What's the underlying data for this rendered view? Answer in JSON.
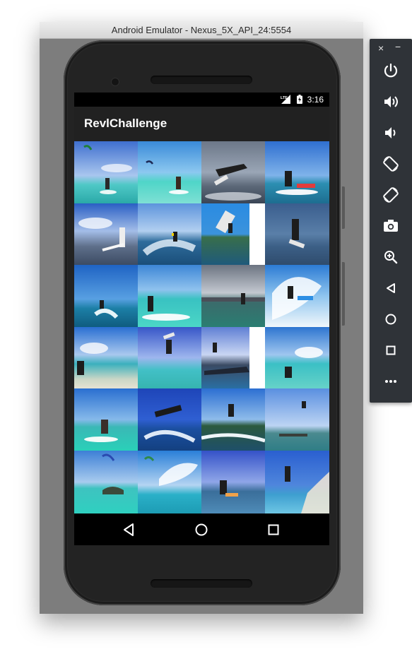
{
  "window": {
    "title": "Android Emulator - Nexus_5X_API_24:5554"
  },
  "status_bar": {
    "time": "3:16",
    "icons": [
      "lte-signal-icon",
      "battery-icon"
    ]
  },
  "app_bar": {
    "title": "RevlChallenge"
  },
  "photo_grid": {
    "columns": 4,
    "rows": 6,
    "subject": "kitesurfing photos",
    "count": 24
  },
  "nav_bar": {
    "buttons": [
      "back-icon",
      "home-icon",
      "recents-icon"
    ]
  },
  "emulator_toolbar": {
    "close_label": "×",
    "minimize_label": "−",
    "buttons": [
      "power-icon",
      "volume-up-icon",
      "volume-down-icon",
      "rotate-left-icon",
      "rotate-right-icon",
      "camera-icon",
      "zoom-icon",
      "back-icon",
      "home-icon",
      "overview-icon",
      "more-icon"
    ]
  },
  "colors": {
    "app_bar": "#212121",
    "status_bar": "#000000",
    "toolbar": "#2f3338",
    "window_bg": "#7d7d7d"
  }
}
